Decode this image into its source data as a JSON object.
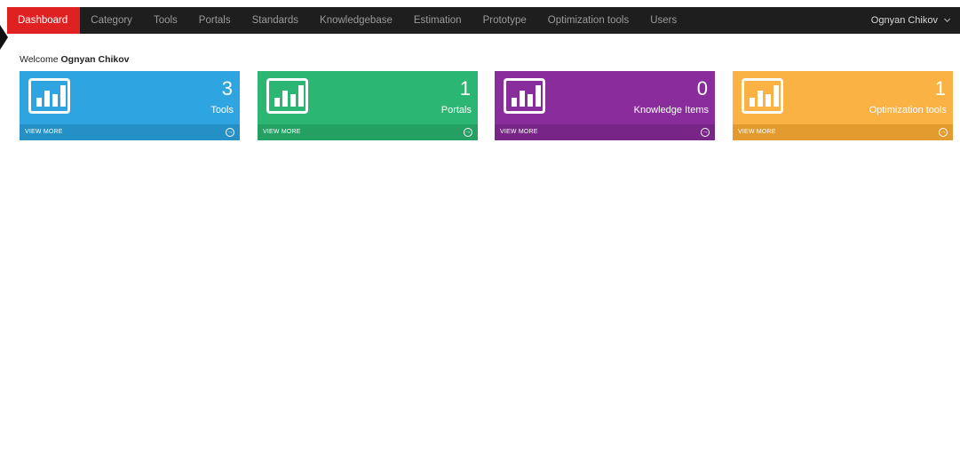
{
  "navbar": {
    "items": [
      {
        "label": "Dashboard"
      },
      {
        "label": "Category"
      },
      {
        "label": "Tools"
      },
      {
        "label": "Portals"
      },
      {
        "label": "Standards"
      },
      {
        "label": "Knowledgebase"
      },
      {
        "label": "Estimation"
      },
      {
        "label": "Prototype"
      },
      {
        "label": "Optimization tools"
      },
      {
        "label": "Users"
      }
    ],
    "user_name": "Ognyan Chikov"
  },
  "welcome": {
    "prefix": "Welcome",
    "name": "Ognyan Chikov"
  },
  "tiles": [
    {
      "count": "3",
      "label": "Tools",
      "link": "VIEW MORE",
      "color": "#2ea4e0",
      "footer_color": "#2590c6",
      "icon": "bar-chart-icon"
    },
    {
      "count": "1",
      "label": "Portals",
      "link": "VIEW MORE",
      "color": "#2bb673",
      "footer_color": "#24a062",
      "icon": "bar-chart-icon"
    },
    {
      "count": "0",
      "label": "Knowledge Items",
      "link": "VIEW MORE",
      "color": "#8a2d9c",
      "footer_color": "#772587",
      "icon": "bar-chart-icon"
    },
    {
      "count": "1",
      "label": "Optimization tools",
      "link": "VIEW MORE",
      "color": "#fbb245",
      "footer_color": "#e39b2f",
      "icon": "bar-chart-icon"
    }
  ]
}
